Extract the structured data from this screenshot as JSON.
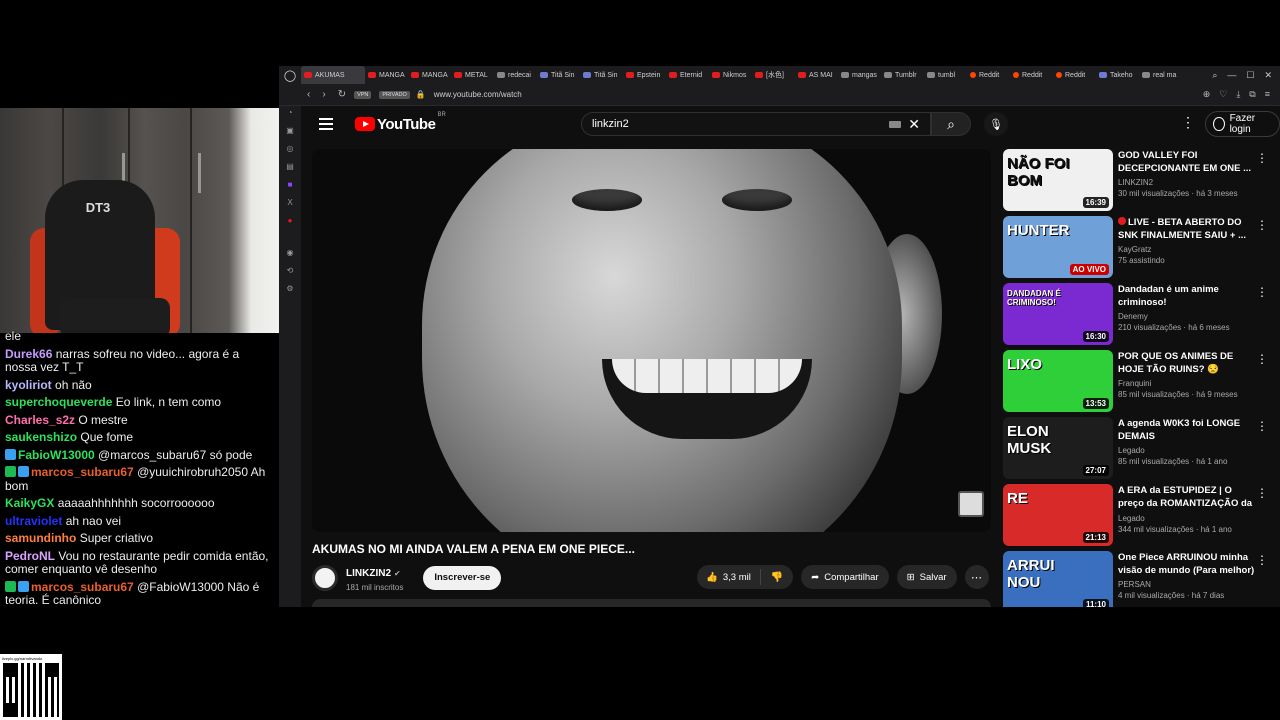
{
  "browser": {
    "tabs": [
      "AKUMAS",
      "MANGA",
      "MANGA",
      "METAL",
      "redecai",
      "Titã Sin",
      "Titã Sin",
      "Epstein",
      "Eternid",
      "Nikmos",
      "[水色]",
      "AS MAI",
      "mangas",
      "Tumblr",
      "tumbl",
      "Reddit",
      "Reddit",
      "Reddit",
      "Takeho",
      "real ma"
    ],
    "url": "www.youtube.com/watch",
    "vpn_label": "VPN",
    "private_label": "PRIVADO"
  },
  "youtube": {
    "logo_text": "YouTube",
    "country_code": "BR",
    "search_query": "linkzin2",
    "login_label": "Fazer login"
  },
  "video": {
    "title": "AKUMAS NO MI AINDA VALEM A PENA EM ONE PIECE...",
    "channel": "LINKZIN2",
    "subscribers": "181 mil inscritos",
    "subscribe_label": "Inscrever-se",
    "likes": "3,3 mil",
    "share_label": "Compartilhar",
    "save_label": "Salvar"
  },
  "recommendations": [
    {
      "title": "GOD VALLEY FOI DECEPCIONANTE EM ONE ...",
      "channel": "LINKZIN2",
      "stats": "30 mil visualizações · há 3 meses",
      "duration": "16:39",
      "thumb_text": "NÃO FOI BOM",
      "thumb_color": "#f0f0f0"
    },
    {
      "title": "LIVE - BETA ABERTO DO SNK FINALMENTE SAIU + ...",
      "channel": "KayGratz",
      "stats": "75 assistindo",
      "duration": "AO VIVO",
      "thumb_text": "HUNTER",
      "thumb_color": "#6fa0d8"
    },
    {
      "title": "Dandadan é um anime criminoso!",
      "channel": "Denemy",
      "stats": "210 visualizações · há 6 meses",
      "duration": "16:30",
      "thumb_text": "DANDADAN É CRIMINOSO!",
      "thumb_color": "#7b2ad1"
    },
    {
      "title": "POR QUE OS ANIMES DE HOJE TÃO RUINS? 😒",
      "channel": "Franquini",
      "stats": "85 mil visualizações · há 9 meses",
      "duration": "13:53",
      "thumb_text": "LIXO",
      "thumb_color": "#2fcf3a"
    },
    {
      "title": "A agenda W0K3 foi LONGE DEMAIS",
      "channel": "Legado",
      "stats": "85 mil visualizações · há 1 ano",
      "duration": "27:07",
      "thumb_text": "ELON MUSK",
      "thumb_color": "#1d1d1d"
    },
    {
      "title": "A ERA da ESTUPIDEZ | O preço da ROMANTIZAÇÃO da ...",
      "channel": "Legado",
      "stats": "344 mil visualizações · há 1 ano",
      "duration": "21:13",
      "thumb_text": "RE",
      "thumb_color": "#d92a2a"
    },
    {
      "title": "One Piece ARRUINOU minha visão de mundo (Para melhor)",
      "channel": "PERSAN",
      "stats": "4 mil visualizações · há 7 dias",
      "duration": "11:10",
      "thumb_text": "ARRUI NOU",
      "thumb_color": "#3a6fc0"
    }
  ],
  "chat": [
    {
      "user": "",
      "color": "#eeeeee",
      "badges": [],
      "text": "ele"
    },
    {
      "user": "Durek66",
      "color": "#c79bff",
      "badges": [],
      "text": "narras sofreu no video... agora é a nossa vez T_T"
    },
    {
      "user": "kyoliriot",
      "color": "#b8b8ff",
      "badges": [],
      "text": "oh não"
    },
    {
      "user": "superchoqueverde",
      "color": "#2ee05a",
      "badges": [],
      "text": "Eo link, n tem como"
    },
    {
      "user": "Charles_s2z",
      "color": "#ff6fae",
      "badges": [],
      "text": "O mestre"
    },
    {
      "user": "saukenshizo",
      "color": "#2ee05a",
      "badges": [],
      "text": "Que fome"
    },
    {
      "user": "FabioW13000",
      "color": "#2ee05a",
      "badges": [
        "blue"
      ],
      "text": "@marcos_subaru67 só pode"
    },
    {
      "user": "marcos_subaru67",
      "color": "#e8602c",
      "badges": [
        "green",
        "blue"
      ],
      "text": "@yuuichirobruh2050 Ah bom"
    },
    {
      "user": "KaikyGX",
      "color": "#2ee05a",
      "badges": [],
      "text": "aaaaahhhhhhh socorroooooo"
    },
    {
      "user": "ultraviolet",
      "color": "#2233ff",
      "badges": [],
      "text": "ah nao vei"
    },
    {
      "user": "samundinho",
      "color": "#ff7f3f",
      "badges": [],
      "text": "Super criativo"
    },
    {
      "user": "PedroNL",
      "color": "#d9a4ff",
      "badges": [],
      "text": "Vou no restaurante pedir comida então, comer enquanto vê desenho"
    },
    {
      "user": "marcos_subaru67",
      "color": "#e8602c",
      "badges": [
        "green",
        "blue"
      ],
      "text": "@FabioW13000 Não é teoria. É canônico"
    }
  ],
  "qr_caption": "livepix.gg/narrottvando"
}
